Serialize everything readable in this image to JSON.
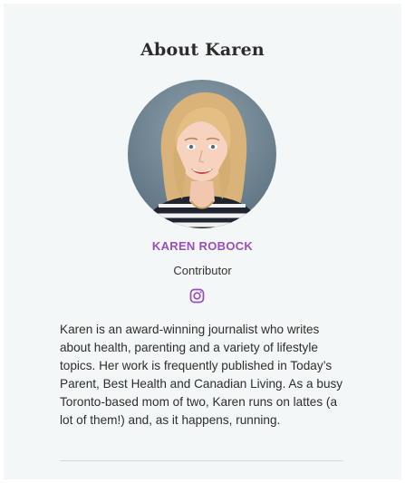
{
  "author": {
    "heading": "About Karen",
    "name": "KAREN ROBOCK",
    "role": "Contributor",
    "bio": "Karen is an award-winning journalist who writes about health, parenting and a variety of lifestyle topics. Her work is frequently published in Today’s Parent, Best Health and Canadian Living. As a busy Toronto-based mom of two, Karen runs on lattes (a lot of them!) and, as it happens, running.",
    "social_icon": "instagram-icon"
  },
  "colors": {
    "background": "#f3f7f7",
    "name_accent": "#9a4fb8",
    "heading": "#2c2c2c",
    "body_text": "#2e2e2e"
  }
}
